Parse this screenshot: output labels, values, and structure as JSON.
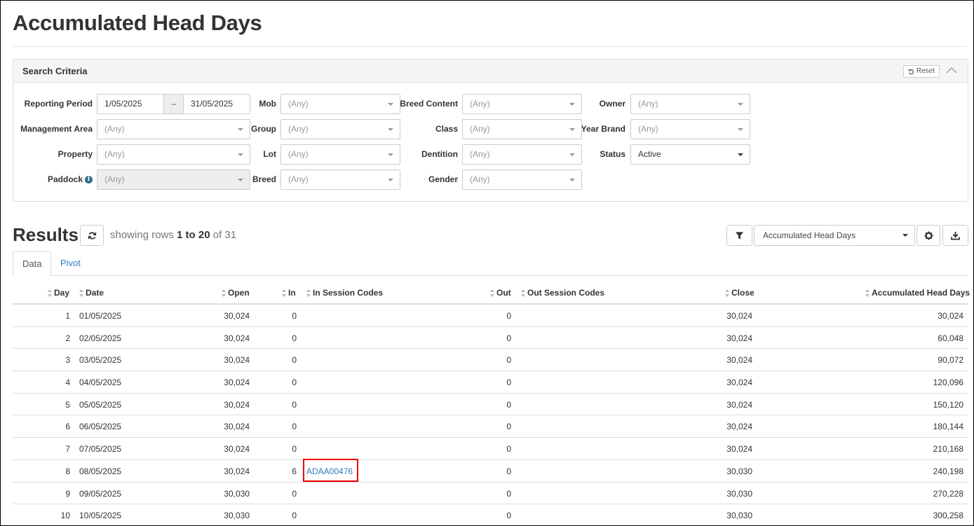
{
  "page": {
    "title": "Accumulated Head Days"
  },
  "search": {
    "title": "Search Criteria",
    "reset_label": "Reset",
    "reporting_period": {
      "label": "Reporting Period",
      "from": "1/05/2025",
      "separator": "–",
      "to": "31/05/2025"
    },
    "mob": {
      "label": "Mob",
      "value": "(Any)"
    },
    "breed_content": {
      "label": "Breed Content",
      "value": "(Any)"
    },
    "owner": {
      "label": "Owner",
      "value": "(Any)"
    },
    "management_area": {
      "label": "Management Area",
      "value": "(Any)"
    },
    "group": {
      "label": "Group",
      "value": "(Any)"
    },
    "class": {
      "label": "Class",
      "value": "(Any)"
    },
    "year_brand": {
      "label": "Year Brand",
      "value": "(Any)"
    },
    "property": {
      "label": "Property",
      "value": "(Any)"
    },
    "lot": {
      "label": "Lot",
      "value": "(Any)"
    },
    "dentition": {
      "label": "Dentition",
      "value": "(Any)"
    },
    "status": {
      "label": "Status",
      "value": "Active"
    },
    "paddock": {
      "label": "Paddock",
      "value": "(Any)"
    },
    "breed": {
      "label": "Breed",
      "value": "(Any)"
    },
    "gender": {
      "label": "Gender",
      "value": "(Any)"
    }
  },
  "results": {
    "title": "Results",
    "showing_prefix": "showing rows",
    "showing_range": "1 to 20",
    "showing_of": "of 31",
    "view_select": "Accumulated Head Days",
    "tabs": [
      "Data",
      "Pivot"
    ]
  },
  "table": {
    "columns": [
      "Day",
      "Date",
      "Open",
      "In",
      "In Session Codes",
      "Out",
      "Out Session Codes",
      "Close",
      "Accumulated Head Days"
    ],
    "rows": [
      [
        "1",
        "01/05/2025",
        "30,024",
        "0",
        "",
        "0",
        "",
        "30,024",
        "30,024"
      ],
      [
        "2",
        "02/05/2025",
        "30,024",
        "0",
        "",
        "0",
        "",
        "30,024",
        "60,048"
      ],
      [
        "3",
        "03/05/2025",
        "30,024",
        "0",
        "",
        "0",
        "",
        "30,024",
        "90,072"
      ],
      [
        "4",
        "04/05/2025",
        "30,024",
        "0",
        "",
        "0",
        "",
        "30,024",
        "120,096"
      ],
      [
        "5",
        "05/05/2025",
        "30,024",
        "0",
        "",
        "0",
        "",
        "30,024",
        "150,120"
      ],
      [
        "6",
        "06/05/2025",
        "30,024",
        "0",
        "",
        "0",
        "",
        "30,024",
        "180,144"
      ],
      [
        "7",
        "07/05/2025",
        "30,024",
        "0",
        "",
        "0",
        "",
        "30,024",
        "210,168"
      ],
      [
        "8",
        "08/05/2025",
        "30,024",
        "6",
        "ADAA00476",
        "0",
        "",
        "30,030",
        "240,198"
      ],
      [
        "9",
        "09/05/2025",
        "30,030",
        "0",
        "",
        "0",
        "",
        "30,030",
        "270,228"
      ],
      [
        "10",
        "10/05/2025",
        "30,030",
        "0",
        "",
        "0",
        "",
        "30,030",
        "300,258"
      ]
    ]
  },
  "colors": {
    "link": "#337ab7",
    "highlight": "#e00000"
  }
}
